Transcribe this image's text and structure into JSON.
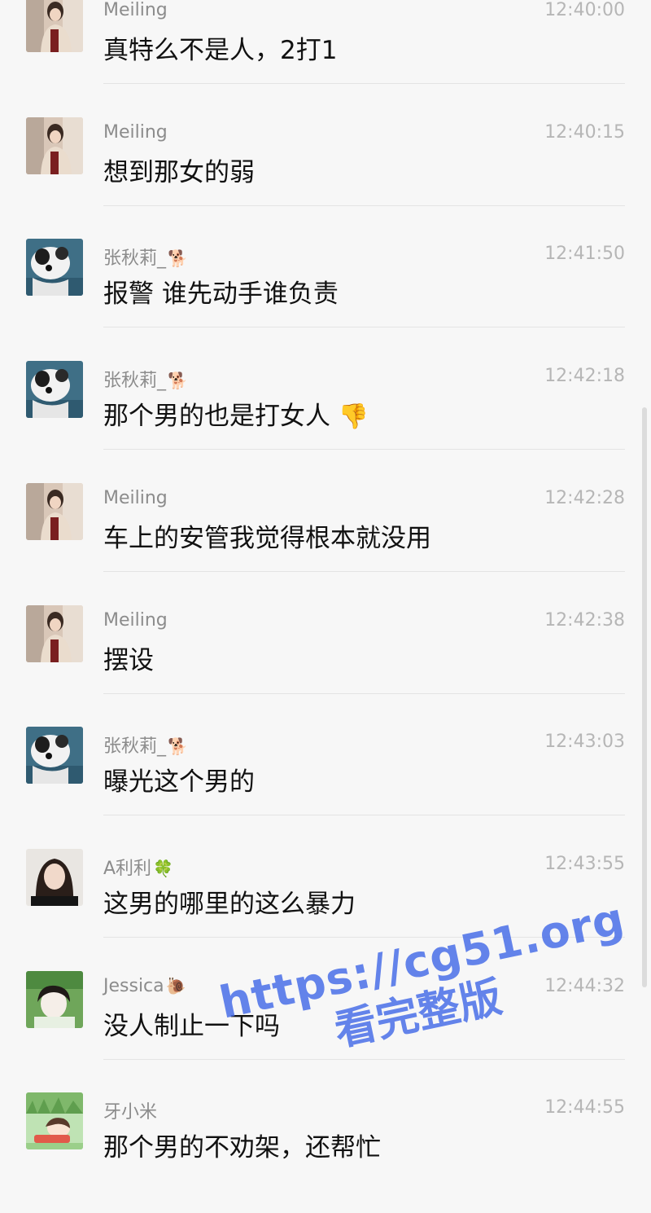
{
  "messages": [
    {
      "sender": "Meiling",
      "sender_emoji": "",
      "time": "12:40:00",
      "text": "真特么不是人，2打1",
      "text_emoji": "",
      "avatar": "photo-girl-mirror-icon"
    },
    {
      "sender": "Meiling",
      "sender_emoji": "",
      "time": "12:40:15",
      "text": "想到那女的弱",
      "text_emoji": "",
      "avatar": "photo-girl-mirror-icon"
    },
    {
      "sender": "张秋莉_",
      "sender_emoji": "🐕",
      "time": "12:41:50",
      "text": "报警 谁先动手谁负责",
      "text_emoji": "",
      "avatar": "photo-dog-icon"
    },
    {
      "sender": "张秋莉_",
      "sender_emoji": "🐕",
      "time": "12:42:18",
      "text": "那个男的也是打女人 ",
      "text_emoji": "👎",
      "avatar": "photo-dog-icon"
    },
    {
      "sender": "Meiling",
      "sender_emoji": "",
      "time": "12:42:28",
      "text": "车上的安管我觉得根本就没用",
      "text_emoji": "",
      "avatar": "photo-girl-mirror-icon"
    },
    {
      "sender": "Meiling",
      "sender_emoji": "",
      "time": "12:42:38",
      "text": "摆设",
      "text_emoji": "",
      "avatar": "photo-girl-mirror-icon"
    },
    {
      "sender": "张秋莉_",
      "sender_emoji": "🐕",
      "time": "12:43:03",
      "text": "曝光这个男的",
      "text_emoji": "",
      "avatar": "photo-dog-icon"
    },
    {
      "sender": "A利利",
      "sender_emoji": "🍀",
      "time": "12:43:55",
      "text": "这男的哪里的这么暴力",
      "text_emoji": "",
      "avatar": "photo-woman-dark-hair-icon"
    },
    {
      "sender": "Jessica",
      "sender_emoji": "🐌",
      "time": "12:44:32",
      "text": "没人制止一下吗",
      "text_emoji": "",
      "avatar": "photo-woman-grass-icon"
    },
    {
      "sender": "牙小米",
      "sender_emoji": "",
      "time": "12:44:55",
      "text": "那个男的不劝架，还帮忙",
      "text_emoji": "",
      "avatar": "photo-anime-icon"
    }
  ],
  "watermark": {
    "line1": "https://cg51.org",
    "line2": "看完整版"
  }
}
